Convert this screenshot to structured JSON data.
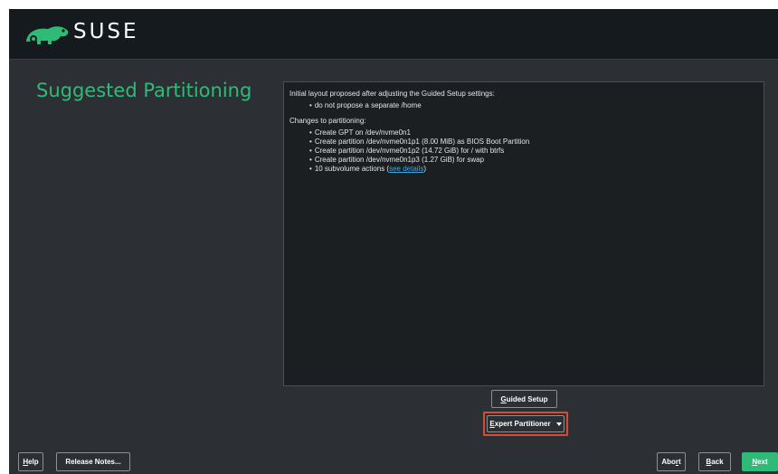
{
  "header": {
    "brand": "SUSE",
    "logo_icon": "suse-chameleon-logo",
    "colors": {
      "background": "#141a1d",
      "accent": "#30ba78"
    }
  },
  "page": {
    "title": "Suggested Partitioning"
  },
  "summary": {
    "intro": "Initial layout proposed after adjusting the Guided Setup settings:",
    "settings": [
      "do not propose a separate /home"
    ],
    "changes_heading": "Changes to partitioning:",
    "changes": [
      "Create GPT on /dev/nvme0n1",
      "Create partition /dev/nvme0n1p1 (8.00 MiB) as BIOS Boot Partition",
      "Create partition /dev/nvme0n1p2 (14.72 GiB) for / with btrfs",
      "Create partition /dev/nvme0n1p3 (1.27 GiB) for swap"
    ],
    "subvolume_prefix": "10 subvolume actions (",
    "subvolume_link": "see details",
    "subvolume_suffix": ")"
  },
  "actions": {
    "guided_setup_accel": "G",
    "guided_setup_rest": "uided Setup",
    "expert_partitioner_accel": "E",
    "expert_partitioner_rest": "xpert Partitioner",
    "expert_partitioner_icon": "caret-down-icon",
    "highlight_color": "#d94a2e"
  },
  "footer": {
    "help_accel": "H",
    "help_rest": "elp",
    "release_notes": "Release Notes...",
    "abort_pre": "Abo",
    "abort_accel": "r",
    "abort_post": "t",
    "back_accel": "B",
    "back_rest": "ack",
    "next_accel": "N",
    "next_rest": "ext",
    "next_color": "#30ba78"
  }
}
